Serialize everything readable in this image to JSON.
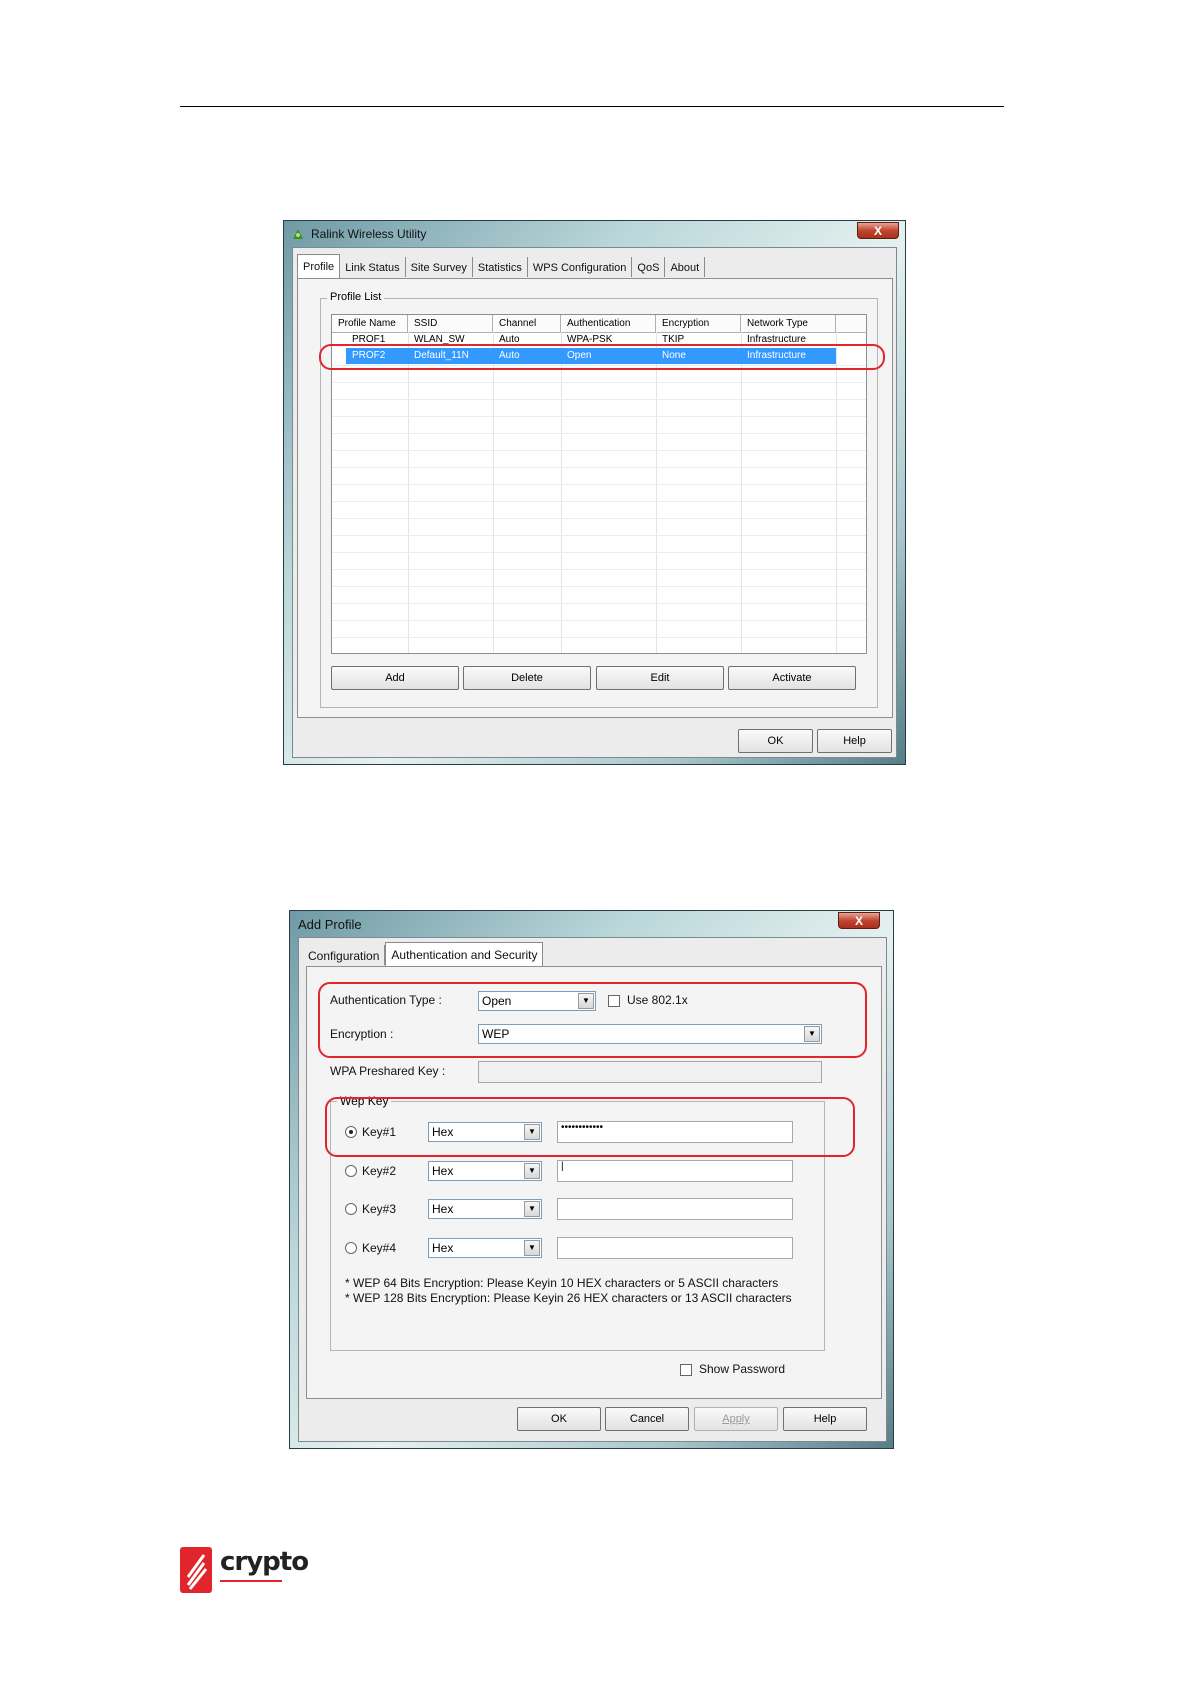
{
  "utility_window": {
    "title": "Ralink Wireless Utility",
    "tabs": [
      "Profile",
      "Link Status",
      "Site Survey",
      "Statistics",
      "WPS Configuration",
      "QoS",
      "About"
    ],
    "active_tab": "Profile",
    "profile_list_label": "Profile List",
    "columns": [
      "Profile Name",
      "SSID",
      "Channel",
      "Authentication",
      "Encryption",
      "Network Type"
    ],
    "rows": [
      {
        "name": "PROF1",
        "ssid": "WLAN_SW",
        "channel": "Auto",
        "auth": "WPA-PSK",
        "enc": "TKIP",
        "type": "Infrastructure",
        "selected": false
      },
      {
        "name": "PROF2",
        "ssid": "Default_11N",
        "channel": "Auto",
        "auth": "Open",
        "enc": "None",
        "type": "Infrastructure",
        "selected": true
      }
    ],
    "buttons": {
      "add": "Add",
      "delete": "Delete",
      "edit": "Edit",
      "activate": "Activate",
      "ok": "OK",
      "help": "Help"
    },
    "close": "X"
  },
  "add_profile_window": {
    "title": "Add Profile",
    "tabs": [
      "Configuration",
      "Authentication and Security"
    ],
    "active_tab": "Authentication and Security",
    "auth_type_label": "Authentication Type :",
    "auth_type_value": "Open",
    "use_8021x_label": "Use 802.1x",
    "encryption_label": "Encryption :",
    "encryption_value": "WEP",
    "wpa_key_label": "WPA Preshared Key :",
    "wep_key_label": "Wep Key",
    "keys": [
      {
        "label": "Key#1",
        "format": "Hex",
        "value": "••••••••••••",
        "selected": true
      },
      {
        "label": "Key#2",
        "format": "Hex",
        "value": "|",
        "selected": false
      },
      {
        "label": "Key#3",
        "format": "Hex",
        "value": "",
        "selected": false
      },
      {
        "label": "Key#4",
        "format": "Hex",
        "value": "",
        "selected": false
      }
    ],
    "notes": [
      "* WEP 64 Bits Encryption:  Please Keyin 10 HEX characters or 5 ASCII characters",
      "* WEP 128 Bits Encryption:  Please Keyin 26 HEX characters or 13 ASCII characters"
    ],
    "show_password_label": "Show Password",
    "buttons": {
      "ok": "OK",
      "cancel": "Cancel",
      "apply": "Apply",
      "help": "Help"
    },
    "close": "X"
  },
  "logo": {
    "text": "crypto"
  },
  "colors": {
    "highlight": "#e0252b",
    "selection": "#3399ff"
  }
}
